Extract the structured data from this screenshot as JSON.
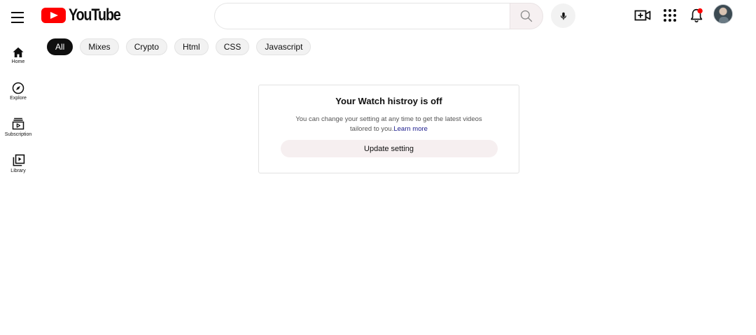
{
  "header": {
    "logo_text": "YouTube",
    "search": {
      "value": "",
      "placeholder": ""
    },
    "notification_badge_color": "#ff0000",
    "icons": [
      "menu-icon",
      "search-icon",
      "microphone-icon",
      "create-video-icon",
      "apps-grid-icon",
      "notifications-bell-icon"
    ]
  },
  "sidebar": {
    "items": [
      {
        "label": "Home",
        "icon": "home-icon"
      },
      {
        "label": "Explore",
        "icon": "compass-icon"
      },
      {
        "label": "Subscription",
        "icon": "subscriptions-icon"
      },
      {
        "label": "Library",
        "icon": "library-icon"
      }
    ]
  },
  "chips": [
    {
      "label": "All",
      "active": true
    },
    {
      "label": "Mixes",
      "active": false
    },
    {
      "label": "Crypto",
      "active": false
    },
    {
      "label": "Html",
      "active": false
    },
    {
      "label": "CSS",
      "active": false
    },
    {
      "label": "Javascript",
      "active": false
    }
  ],
  "card": {
    "title": "Your Watch histroy is off",
    "description": "You can change your setting at any time to get the latest videos tailored to you.",
    "link_text": "Learn more",
    "button_label": "Update setting"
  },
  "colors": {
    "brand_red": "#ff0000",
    "chip_active_bg": "#0f0f0f",
    "button_bg": "#f6eff0"
  }
}
